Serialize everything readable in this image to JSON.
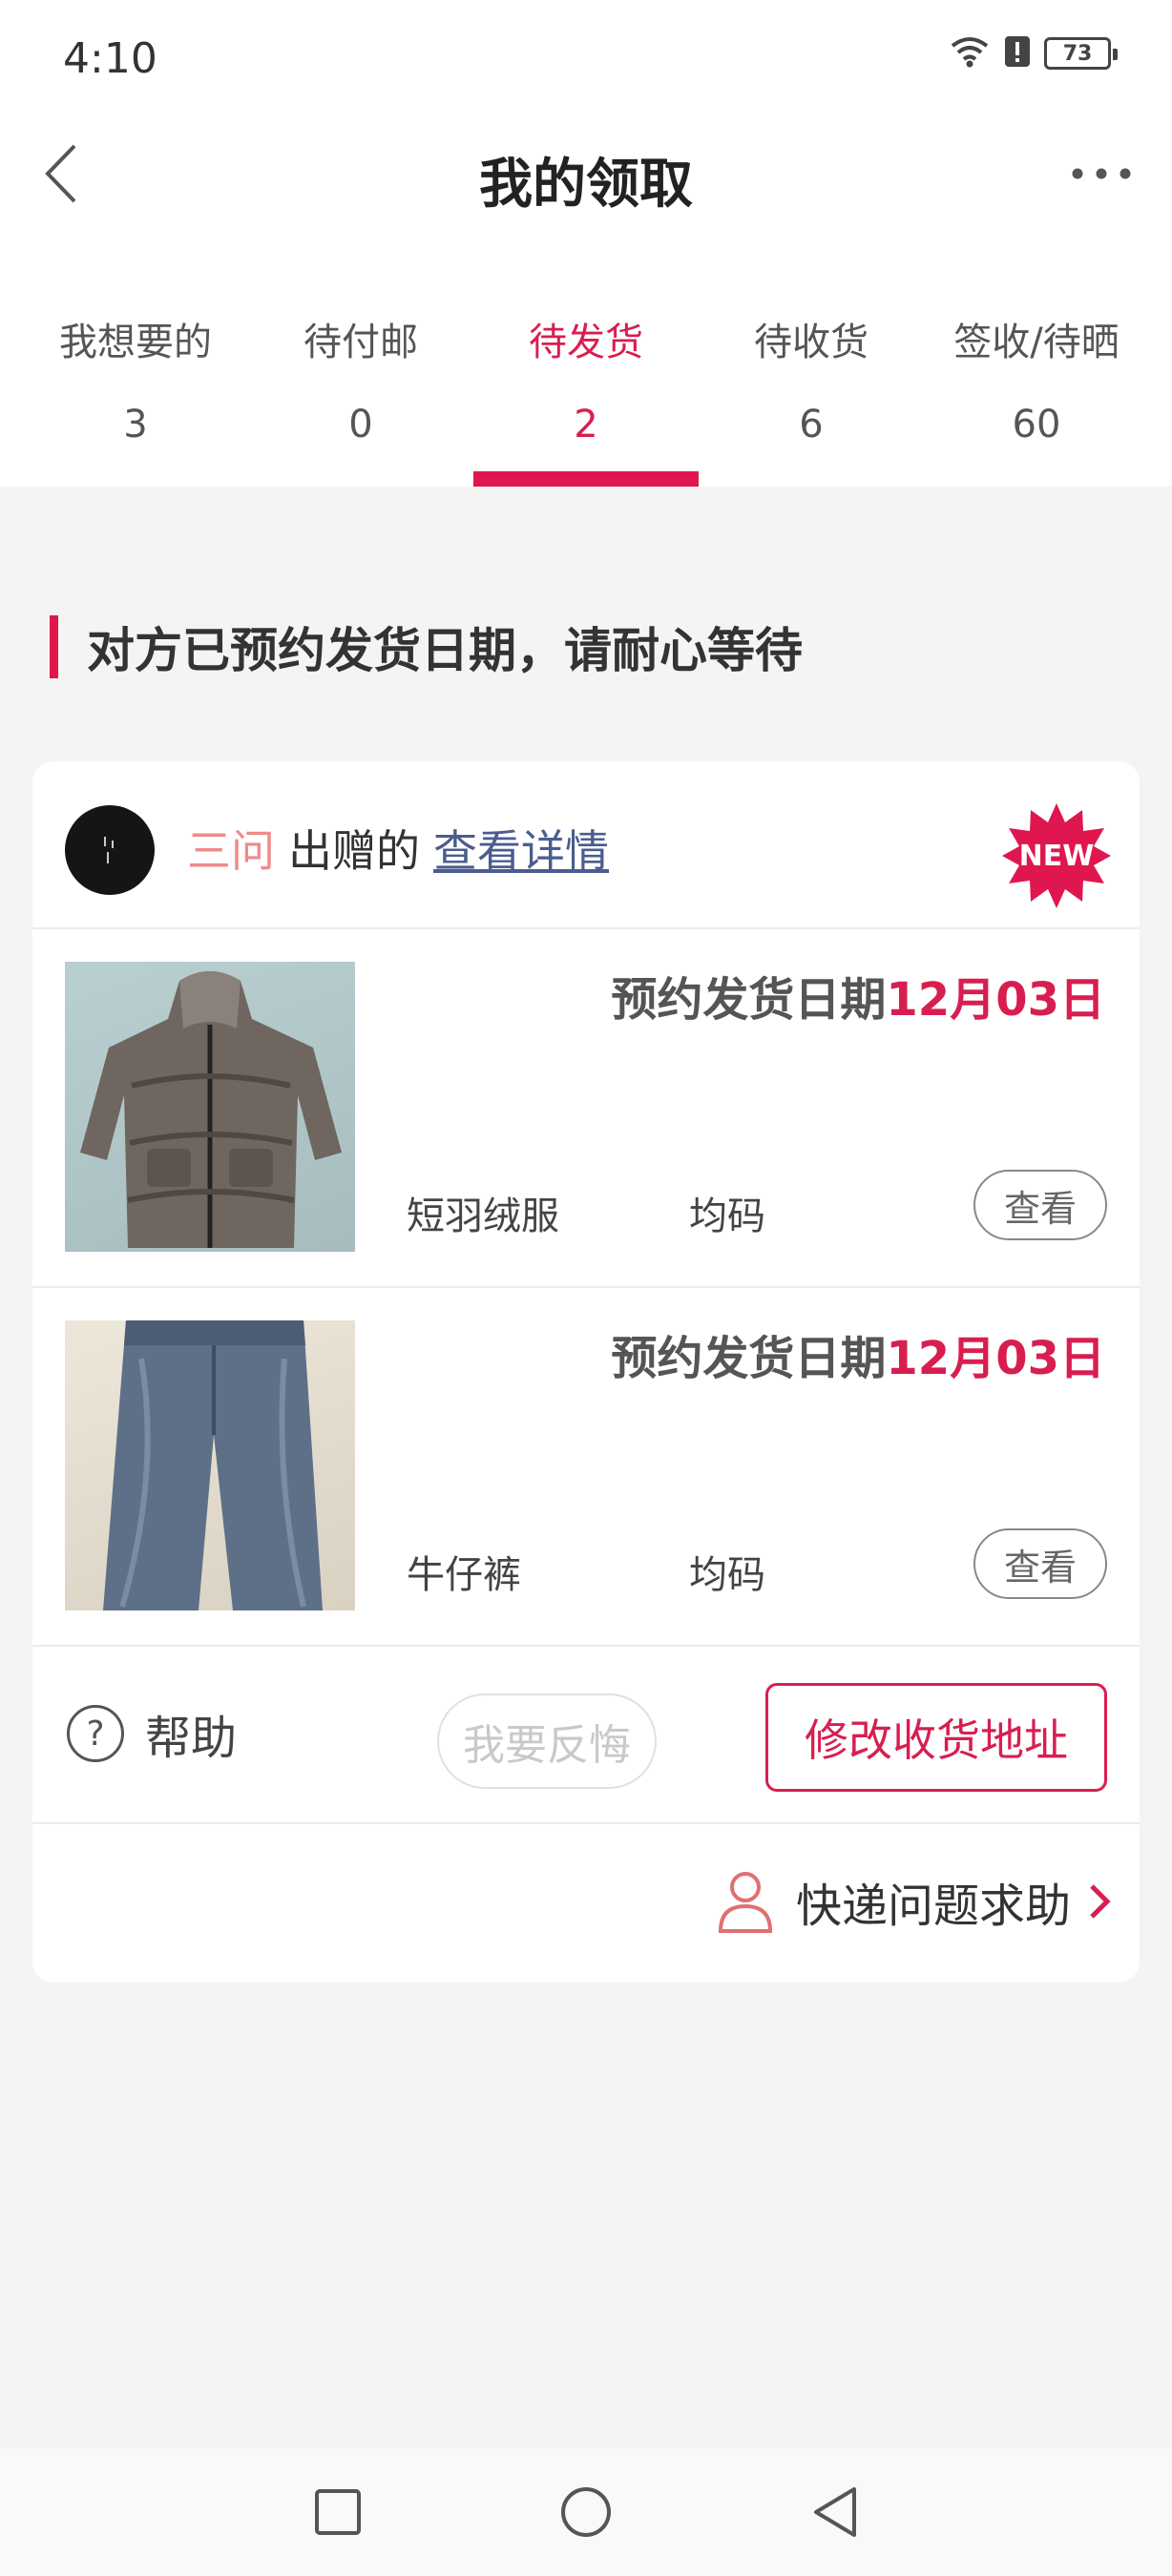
{
  "status_bar": {
    "time": "4:10",
    "battery": "73",
    "icons": [
      "wifi-icon",
      "alert-icon",
      "battery-icon"
    ]
  },
  "header": {
    "title": "我的领取",
    "back_icon": "chevron-left-icon",
    "more_icon": "more-dots-icon"
  },
  "tabs": [
    {
      "label": "我想要的",
      "count": "3"
    },
    {
      "label": "待付邮",
      "count": "0"
    },
    {
      "label": "待发货",
      "count": "2",
      "active": true
    },
    {
      "label": "待收货",
      "count": "6"
    },
    {
      "label": "签收/待晒",
      "count": "60"
    }
  ],
  "section_heading": "对方已预约发货日期，请耐心等待",
  "card": {
    "giver_name": "三问",
    "giver_action": "出赠的",
    "detail_link": "查看详情",
    "badge": "NEW",
    "items": [
      {
        "ship_label": "预约发货日期",
        "ship_date": "12月03日",
        "name": "短羽绒服",
        "size": "均码",
        "view_label": "查看"
      },
      {
        "ship_label": "预约发货日期",
        "ship_date": "12月03日",
        "name": "牛仔裤",
        "size": "均码",
        "view_label": "查看"
      }
    ],
    "help_label": "帮助",
    "regret_label": "我要反悔",
    "address_label": "修改收货地址",
    "express_label": "快递问题求助"
  },
  "colors": {
    "accent": "#d81e4f",
    "giver_name": "#f08a8a",
    "link": "#4b5d8f"
  }
}
